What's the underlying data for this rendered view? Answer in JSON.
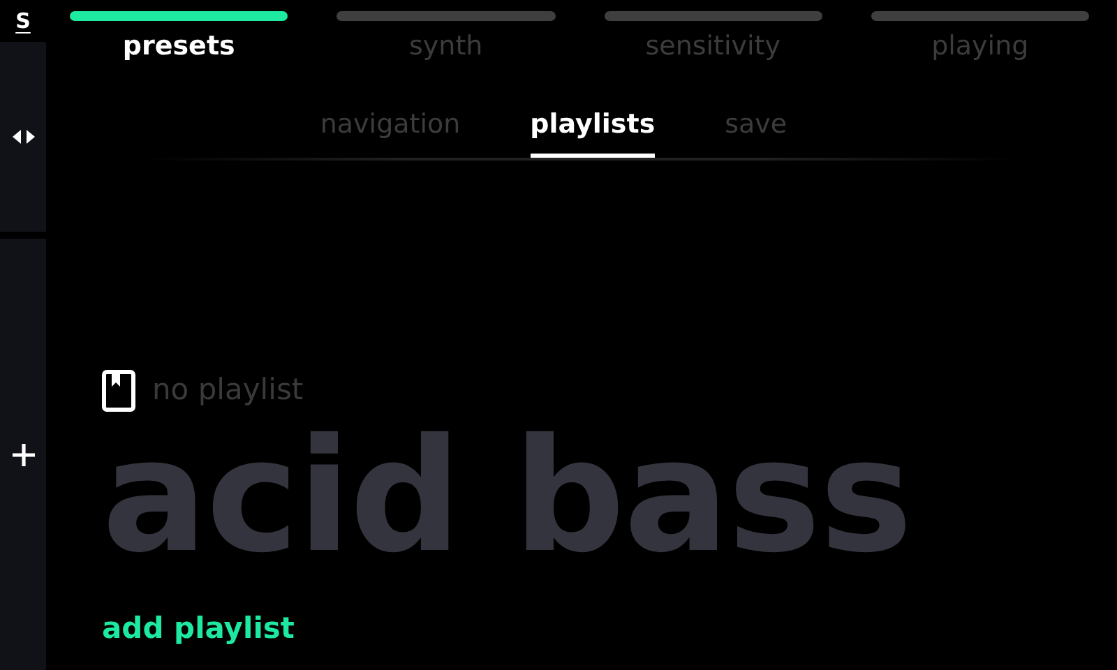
{
  "sidebar": {
    "logo": "S",
    "items": [
      {
        "kind": "arrows"
      },
      {
        "kind": "plus"
      }
    ]
  },
  "tabs": [
    {
      "label": "presets",
      "selected": true
    },
    {
      "label": "synth",
      "selected": false
    },
    {
      "label": "sensitivity",
      "selected": false
    },
    {
      "label": "playing",
      "selected": false
    }
  ],
  "subtabs": [
    {
      "label": "navigation",
      "selected": false
    },
    {
      "label": "playlists",
      "selected": true
    },
    {
      "label": "save",
      "selected": false
    }
  ],
  "playlist": {
    "status": "no playlist",
    "preset_name": "acid bass",
    "add_button": "add playlist"
  }
}
